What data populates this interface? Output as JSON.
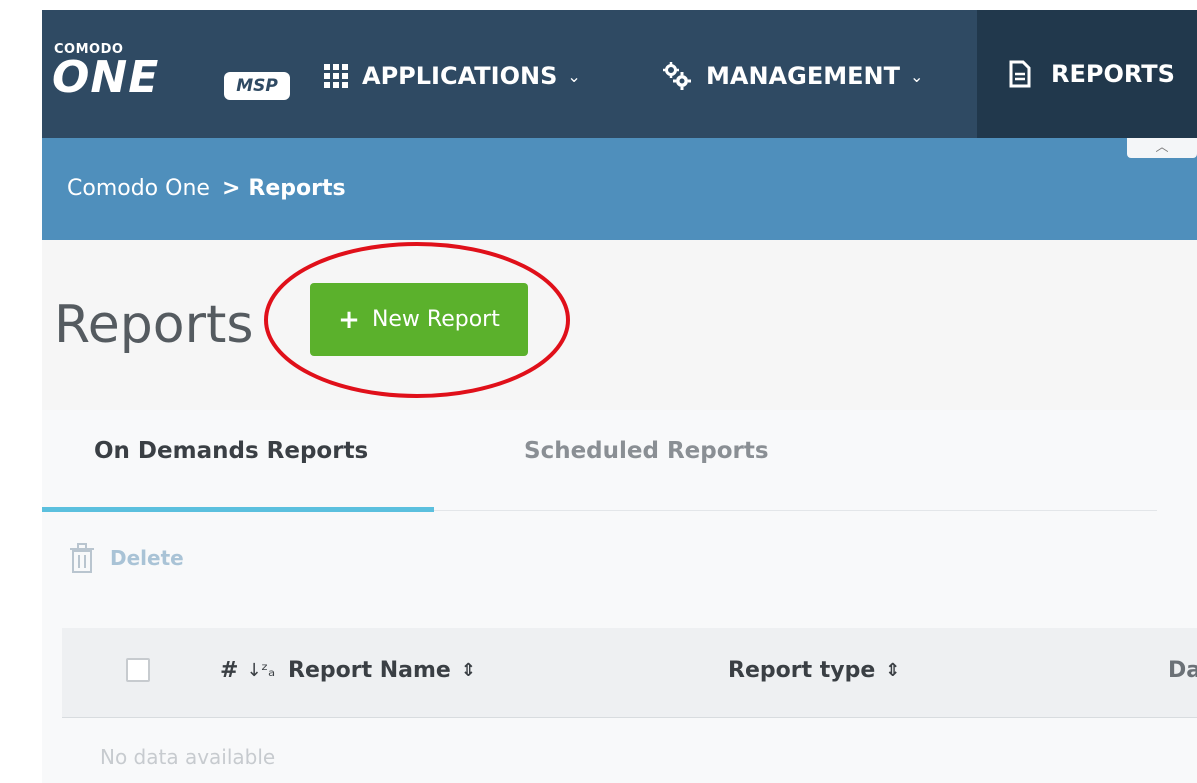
{
  "brand": {
    "company": "COMODO",
    "product": "ONE",
    "edition": "MSP"
  },
  "nav": {
    "items": [
      {
        "label": "APPLICATIONS",
        "icon": "apps-grid-icon",
        "has_dropdown": true
      },
      {
        "label": "MANAGEMENT",
        "icon": "gears-icon",
        "has_dropdown": true
      },
      {
        "label": "REPORTS",
        "icon": "report-document-icon",
        "active": true
      }
    ]
  },
  "breadcrumb": {
    "root": "Comodo One",
    "separator": ">",
    "current": "Reports"
  },
  "page": {
    "title": "Reports",
    "new_report_label": "New Report",
    "new_report_icon": "+"
  },
  "tabs": [
    {
      "label": "On Demands Reports",
      "active": true
    },
    {
      "label": "Scheduled Reports",
      "active": false
    }
  ],
  "toolbar": {
    "delete_label": "Delete"
  },
  "table": {
    "columns": [
      "#",
      "Report Name",
      "Report type",
      "Da"
    ],
    "empty_text": "No data available"
  },
  "colors": {
    "nav_bg": "#2f4a63",
    "nav_active_bg": "#21384c",
    "breadcrumb_bg": "#4f8fbc",
    "primary_button": "#5bb12c",
    "tab_active_underline": "#5bc0de",
    "highlight_circle": "#e0101a"
  }
}
